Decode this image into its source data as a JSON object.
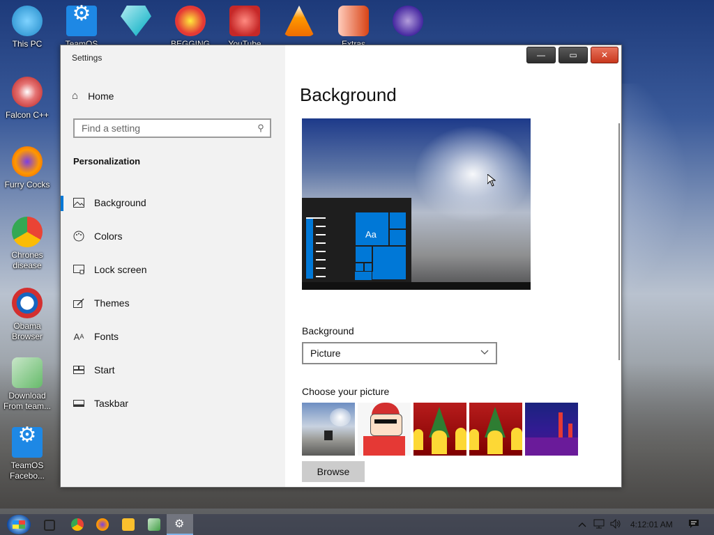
{
  "desktop": {
    "icons": [
      {
        "label": "This PC",
        "color": "#3aa6e0"
      },
      {
        "label": "Falcon C++",
        "color": "#c0392b"
      },
      {
        "label": "Furry Cocks",
        "color": "#f57c00"
      },
      {
        "label": "Chrones disease",
        "color": "#34a853"
      },
      {
        "label": "Obama Browser",
        "color": "#d32f2f"
      },
      {
        "label": "Download From team...",
        "color": "#66bb6a"
      },
      {
        "label": "TeamOS Facebo...",
        "color": "#1e88e5"
      }
    ],
    "top_icons": [
      {
        "label": "TeamOS",
        "color": "#1e88e5"
      },
      {
        "label": "",
        "color": "#26c6da"
      },
      {
        "label": "BEGGING LOL",
        "color": "#e53935"
      },
      {
        "label": "YouTube",
        "color": "#c62828"
      },
      {
        "label": "",
        "color": "#ef6c00"
      },
      {
        "label": "Extras",
        "color": "#d84315"
      },
      {
        "label": "",
        "color": "#5e35b1"
      }
    ]
  },
  "window": {
    "title": "Settings",
    "buttons": {
      "minimize": "—",
      "maximize": "▭",
      "close": "✕"
    }
  },
  "sidebar": {
    "home_label": "Home",
    "search_placeholder": "Find a setting",
    "section_title": "Personalization",
    "items": [
      {
        "label": "Background",
        "icon": "picture-icon",
        "glyph": "▭"
      },
      {
        "label": "Colors",
        "icon": "palette-icon",
        "glyph": "◔"
      },
      {
        "label": "Lock screen",
        "icon": "lock-screen-icon",
        "glyph": "▣"
      },
      {
        "label": "Themes",
        "icon": "themes-icon",
        "glyph": "✎"
      },
      {
        "label": "Fonts",
        "icon": "fonts-icon",
        "glyph": "A"
      },
      {
        "label": "Start",
        "icon": "start-icon",
        "glyph": "▦"
      },
      {
        "label": "Taskbar",
        "icon": "taskbar-icon",
        "glyph": "▬"
      }
    ]
  },
  "main": {
    "title": "Background",
    "preview_sample_text": "Aa",
    "background_label": "Background",
    "background_value": "Picture",
    "choose_picture_label": "Choose your picture",
    "browse_label": "Browse"
  },
  "taskbar": {
    "clock": "4:12:01 AM"
  },
  "colors": {
    "accent": "#0078d7"
  }
}
